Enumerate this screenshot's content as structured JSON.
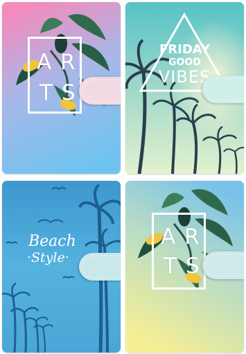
{
  "products": [
    {
      "id": "arts-pink-blue",
      "letters": [
        "A",
        "R",
        "T",
        "S"
      ]
    },
    {
      "id": "friday-good-vibes",
      "lines": [
        "FRIDAY",
        "GOOD",
        "VIBES"
      ]
    },
    {
      "id": "beach-style",
      "lines": [
        "Beach",
        "·Style·"
      ]
    },
    {
      "id": "arts-blue-yellow",
      "letters": [
        "A",
        "R",
        "T",
        "S"
      ]
    }
  ],
  "colors": {
    "card1_top": "#f08cc0",
    "card1_bottom": "#7cc7ee",
    "card2_top": "#5fc4c4",
    "card2_bottom": "#dcefd0",
    "card3_top": "#3f9ed0",
    "card3_bottom": "#5ab8e0",
    "card4_top": "#7ec4e8",
    "card4_bottom": "#f4ee96",
    "clasp_pink": "#f3d9e4",
    "clasp_teal": "#cfeee9",
    "clasp_blue": "#c9e8ea",
    "palm_dark": "#2a3e4e"
  }
}
